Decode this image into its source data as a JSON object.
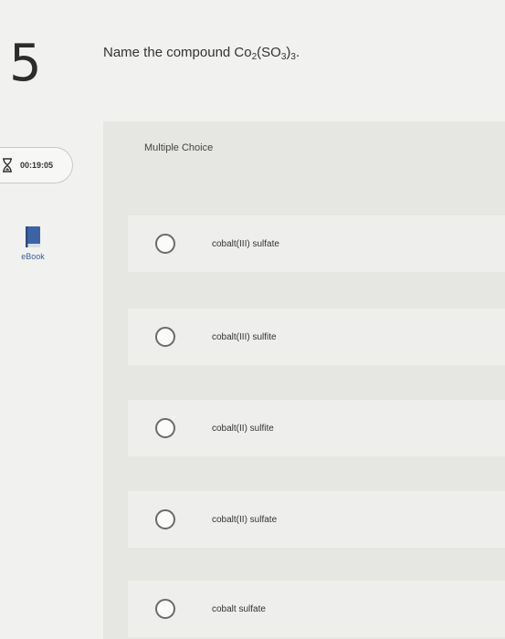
{
  "question": {
    "number": "5",
    "prefix": "Name the compound Co",
    "sub1": "2",
    "mid": "(SO",
    "sub2": "3",
    "close": ")",
    "sub3": "3",
    "suffix": "."
  },
  "timer": {
    "time": "00:19:05",
    "icon": "hourglass-icon"
  },
  "ebook": {
    "label": "eBook",
    "icon": "book-icon",
    "color": "#3c63a6"
  },
  "section_label": "Multiple Choice",
  "options": [
    {
      "label": "cobalt(III) sulfate"
    },
    {
      "label": "cobalt(III) sulfite"
    },
    {
      "label": "cobalt(II) sulfite"
    },
    {
      "label": "cobalt(II) sulfate"
    },
    {
      "label": "cobalt sulfate"
    }
  ]
}
